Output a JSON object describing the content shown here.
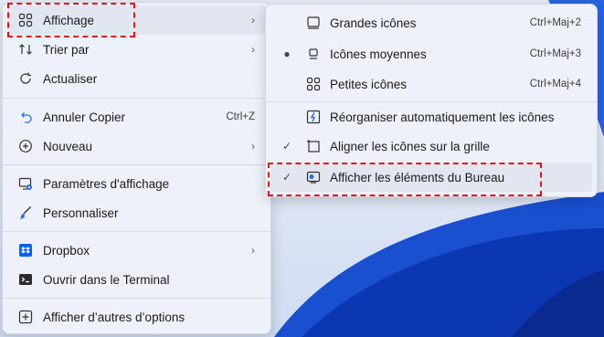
{
  "main_menu": {
    "items": [
      {
        "label": "Affichage",
        "icon": "grid-icon"
      },
      {
        "label": "Trier par",
        "icon": "sort-icon"
      },
      {
        "label": "Actualiser",
        "icon": "refresh-icon"
      },
      {
        "label": "Annuler Copier",
        "icon": "undo-icon",
        "shortcut": "Ctrl+Z"
      },
      {
        "label": "Nouveau",
        "icon": "new-icon"
      },
      {
        "label": "Paramètres d'affichage",
        "icon": "display-settings-icon"
      },
      {
        "label": "Personnaliser",
        "icon": "brush-icon"
      },
      {
        "label": "Dropbox",
        "icon": "dropbox-icon"
      },
      {
        "label": "Ouvrir dans le Terminal",
        "icon": "terminal-icon"
      },
      {
        "label": "Afficher d’autres d’options",
        "icon": "more-options-icon"
      }
    ]
  },
  "sub_menu": {
    "items": [
      {
        "label": "Grandes icônes",
        "shortcut": "Ctrl+Maj+2",
        "icon": "large-icons-icon"
      },
      {
        "label": "Icônes moyennes",
        "shortcut": "Ctrl+Maj+3",
        "icon": "medium-icons-icon",
        "selected": true
      },
      {
        "label": "Petites icônes",
        "shortcut": "Ctrl+Maj+4",
        "icon": "small-icons-icon"
      },
      {
        "label": "Réorganiser automatiquement les icônes",
        "icon": "auto-arrange-icon"
      },
      {
        "label": "Aligner les icônes sur la grille",
        "icon": "align-grid-icon",
        "checked": true
      },
      {
        "label": "Afficher les éléments du Bureau",
        "icon": "show-desktop-icons-icon",
        "checked": true
      }
    ]
  },
  "colors": {
    "highlight_box": "#e01010",
    "dropbox": "#0061fe",
    "accent": "#2f6fd8"
  }
}
